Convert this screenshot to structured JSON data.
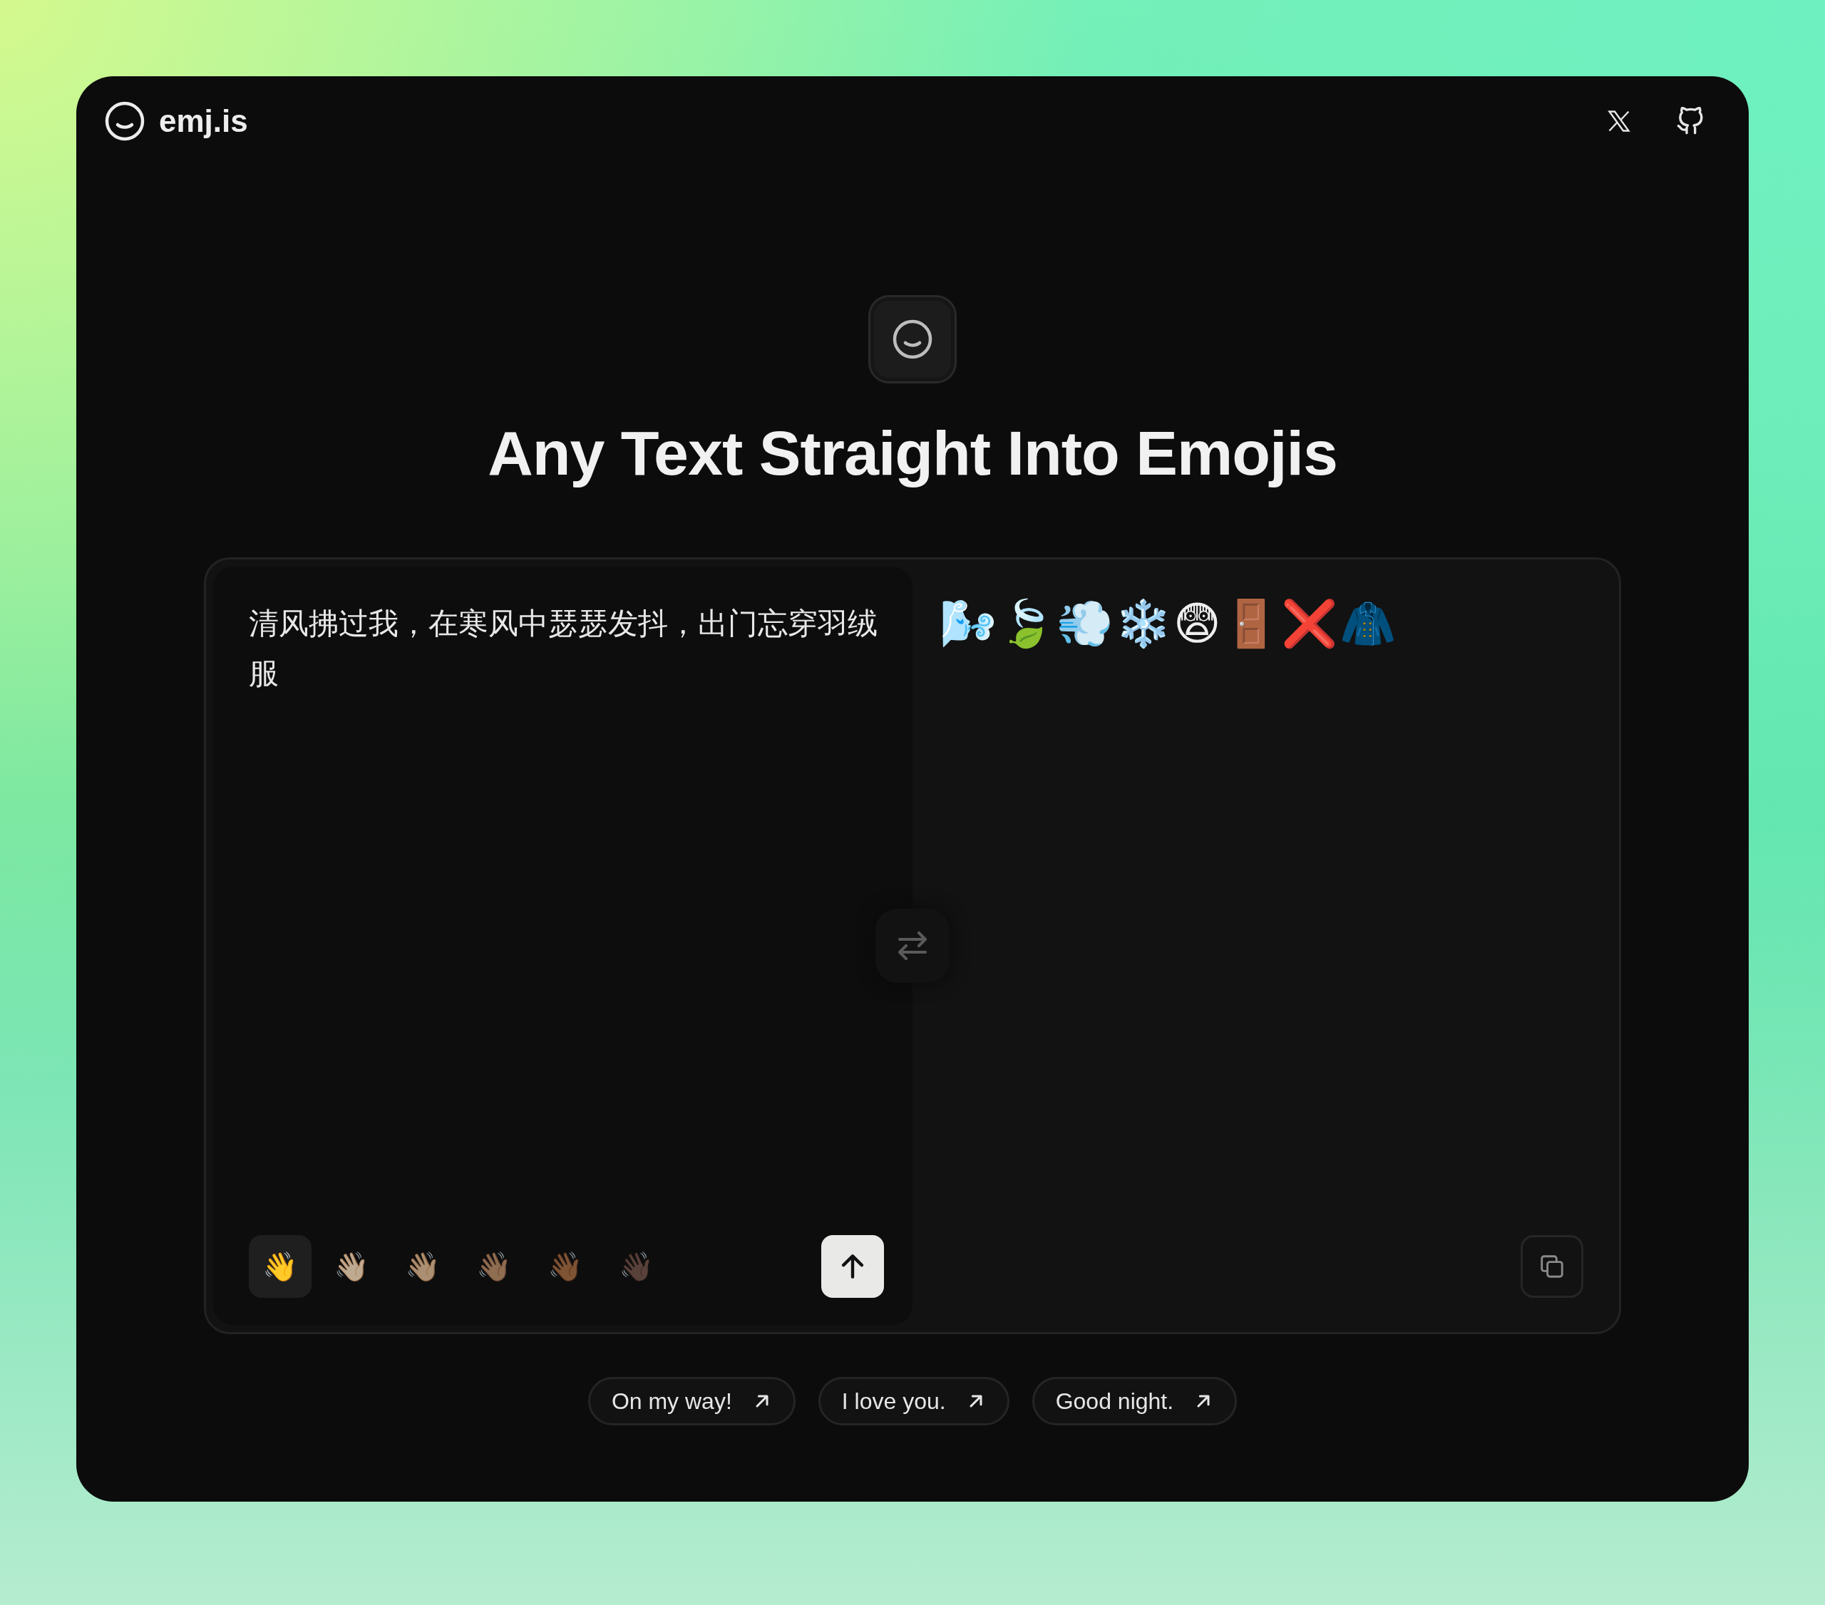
{
  "header": {
    "brand": "emj.is"
  },
  "title": "Any Text Straight Into Emojis",
  "input": {
    "value": "清风拂过我，在寒风中瑟瑟发抖，出门忘穿羽绒服"
  },
  "output": {
    "value": "🌬️🍃💨❄️😨🚪❌🧥"
  },
  "skin_tones": [
    {
      "emoji": "👋",
      "selected": true
    },
    {
      "emoji": "👋🏻",
      "selected": false
    },
    {
      "emoji": "👋🏼",
      "selected": false
    },
    {
      "emoji": "👋🏽",
      "selected": false
    },
    {
      "emoji": "👋🏾",
      "selected": false
    },
    {
      "emoji": "👋🏿",
      "selected": false
    }
  ],
  "suggestions": [
    {
      "label": "On my way!"
    },
    {
      "label": "I love you."
    },
    {
      "label": "Good night."
    }
  ]
}
